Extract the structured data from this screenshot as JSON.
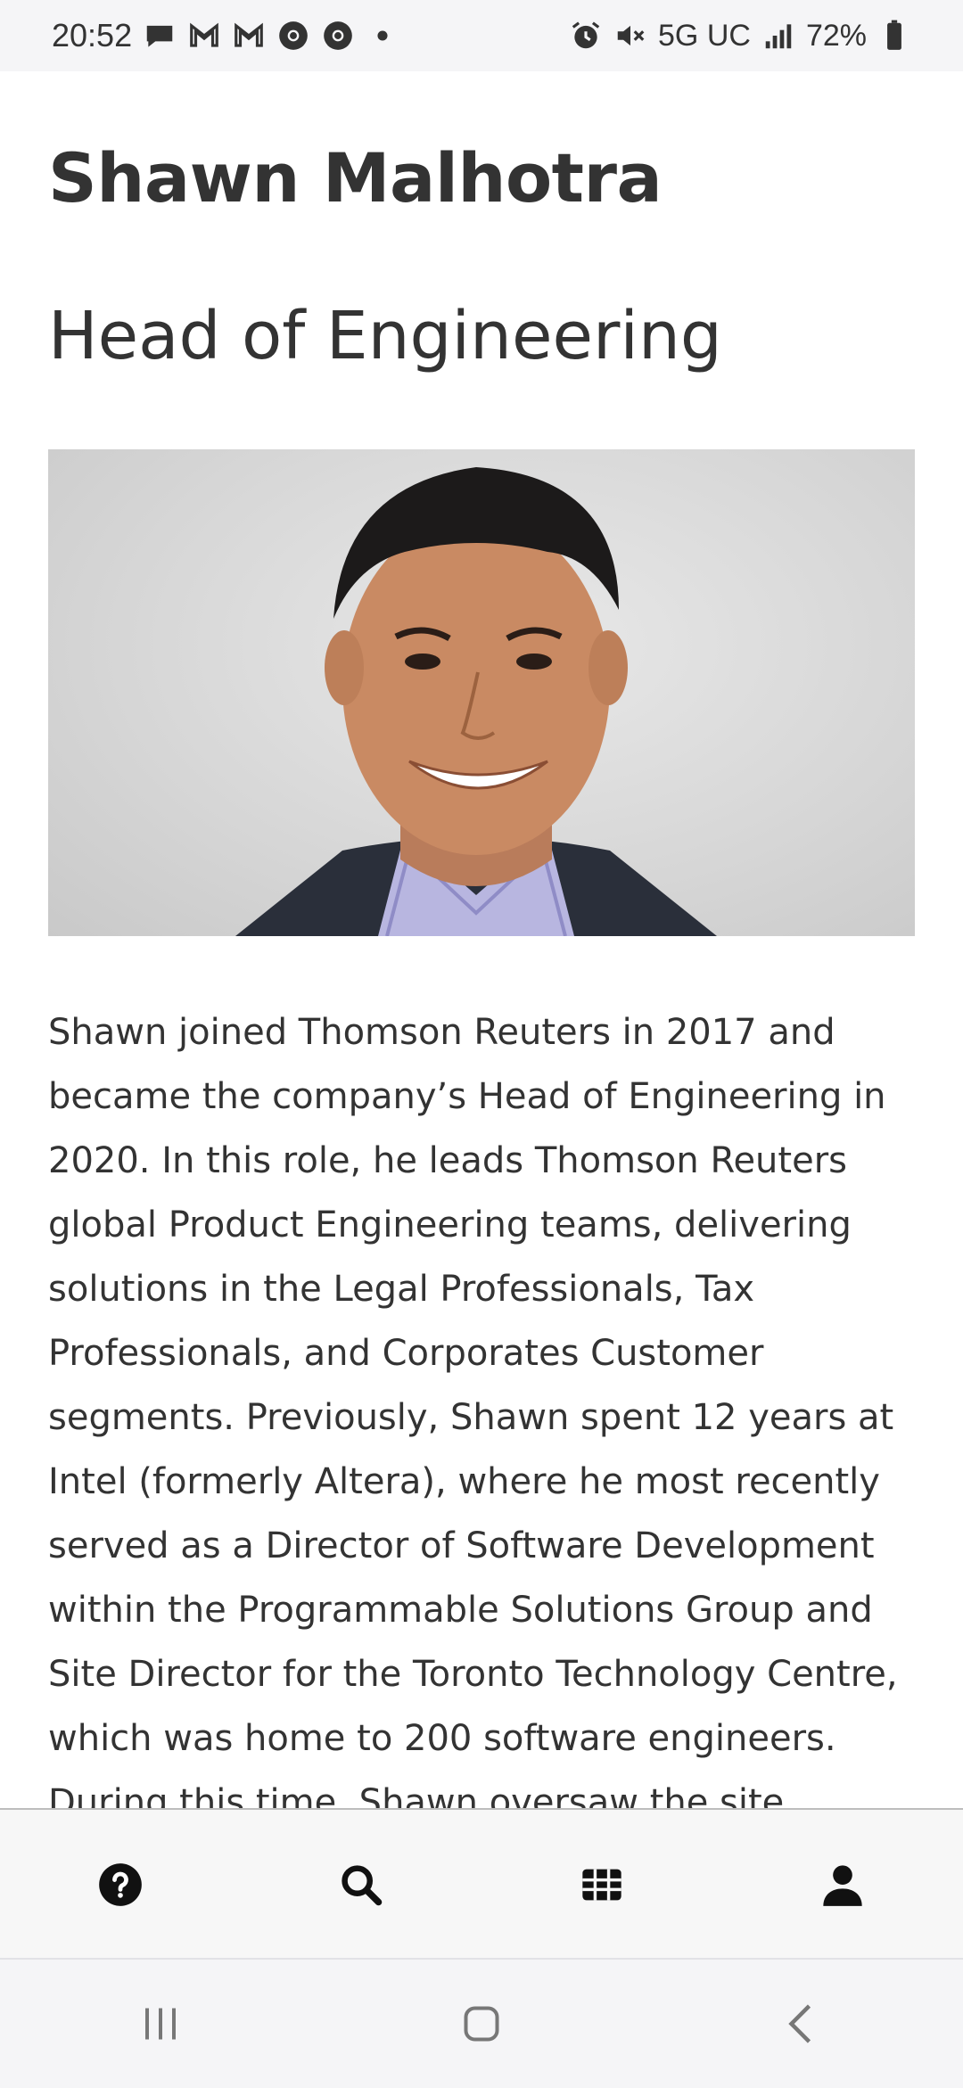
{
  "status_bar": {
    "time": "20:52",
    "network": "5G UC",
    "battery": "72%",
    "left_icons": [
      "chat-icon",
      "gmail-icon",
      "gmail-icon",
      "chrome-icon",
      "chrome-icon",
      "dot-icon"
    ],
    "right_icons": [
      "alarm-icon",
      "mute-icon",
      "signal-icon",
      "battery-icon"
    ]
  },
  "profile": {
    "name": "Shawn Malhotra",
    "title": "Head of Engineering",
    "photo_icon": "portrait-photo",
    "bio": "Shawn joined Thomson Reuters in 2017 and became the company’s Head of Engineering in 2020. In this role, he leads Thomson Reuters global Product Engineering teams, delivering solutions in the Legal Professionals, Tax Professionals, and Corporates Customer segments. Previously, Shawn spent 12 years at Intel (formerly Altera), where he most recently served as a Director of Software Development within the Programmable Solutions Group and Site Director for the Toronto Technology Centre, which was home to 200 software engineers. During this time, Shawn oversaw the site"
  },
  "bottom_nav": {
    "items": [
      "help-icon",
      "search-icon",
      "grid-icon",
      "profile-icon"
    ]
  },
  "system_nav": {
    "items": [
      "recents-icon",
      "home-icon",
      "back-icon"
    ]
  },
  "colors": {
    "text": "#333333",
    "status_bar_bg": "#f5f5f7",
    "nav_bg": "#f7f7f7"
  }
}
